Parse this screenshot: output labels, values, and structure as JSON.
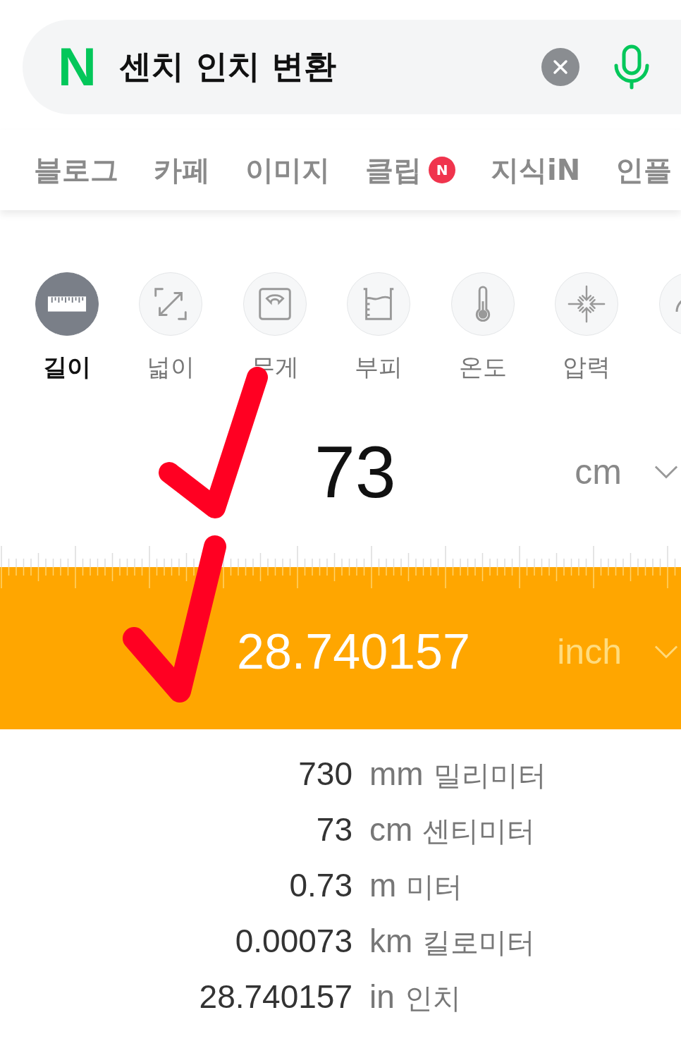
{
  "search": {
    "logo": "N",
    "query": "센치 인치 변환"
  },
  "tabs": [
    {
      "label": "블로그"
    },
    {
      "label": "카페"
    },
    {
      "label": "이미지"
    },
    {
      "label": "클립",
      "badge": "N"
    },
    {
      "label": "지식iN"
    },
    {
      "label": "인플"
    }
  ],
  "categories": [
    {
      "kind": "ruler",
      "label": "길이",
      "selected": true
    },
    {
      "kind": "area",
      "label": "넓이",
      "selected": false
    },
    {
      "kind": "scale",
      "label": "무게",
      "selected": false
    },
    {
      "kind": "beaker",
      "label": "부피",
      "selected": false
    },
    {
      "kind": "thermometer",
      "label": "온도",
      "selected": false
    },
    {
      "kind": "pressure",
      "label": "압력",
      "selected": false
    },
    {
      "kind": "gauge",
      "selected": false
    }
  ],
  "converter": {
    "input": {
      "value": "73",
      "unit": "cm"
    },
    "output": {
      "value": "28.740157",
      "unit": "inch"
    }
  },
  "results": [
    {
      "value": "730",
      "unit": "mm",
      "name": "밀리미터"
    },
    {
      "value": "73",
      "unit": "cm",
      "name": "센티미터"
    },
    {
      "value": "0.73",
      "unit": "m",
      "name": "미터"
    },
    {
      "value": "0.00073",
      "unit": "km",
      "name": "킬로미터"
    },
    {
      "value": "28.740157",
      "unit": "in",
      "name": "인치"
    }
  ]
}
